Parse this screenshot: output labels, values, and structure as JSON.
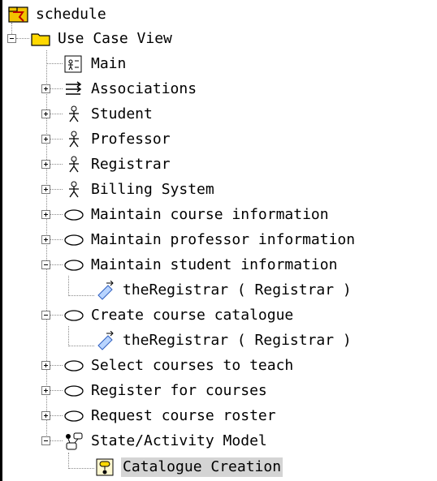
{
  "tree": {
    "root": {
      "label": "schedule"
    },
    "use_case_view": {
      "label": "Use Case View"
    },
    "items": {
      "main": "Main",
      "associations": "Associations",
      "student": "Student",
      "professor": "Professor",
      "registrar": "Registrar",
      "billing": "Billing System",
      "maintain_course": "Maintain course information",
      "maintain_professor": "Maintain professor information",
      "maintain_student": "Maintain student information",
      "the_registrar_1": "theRegistrar ( Registrar )",
      "create_catalogue": "Create course catalogue",
      "the_registrar_2": "theRegistrar ( Registrar )",
      "select_courses": "Select courses to teach",
      "register_courses": "Register for courses",
      "request_roster": "Request course roster",
      "state_model": "State/Activity Model",
      "catalogue_creation": "Catalogue Creation"
    }
  }
}
